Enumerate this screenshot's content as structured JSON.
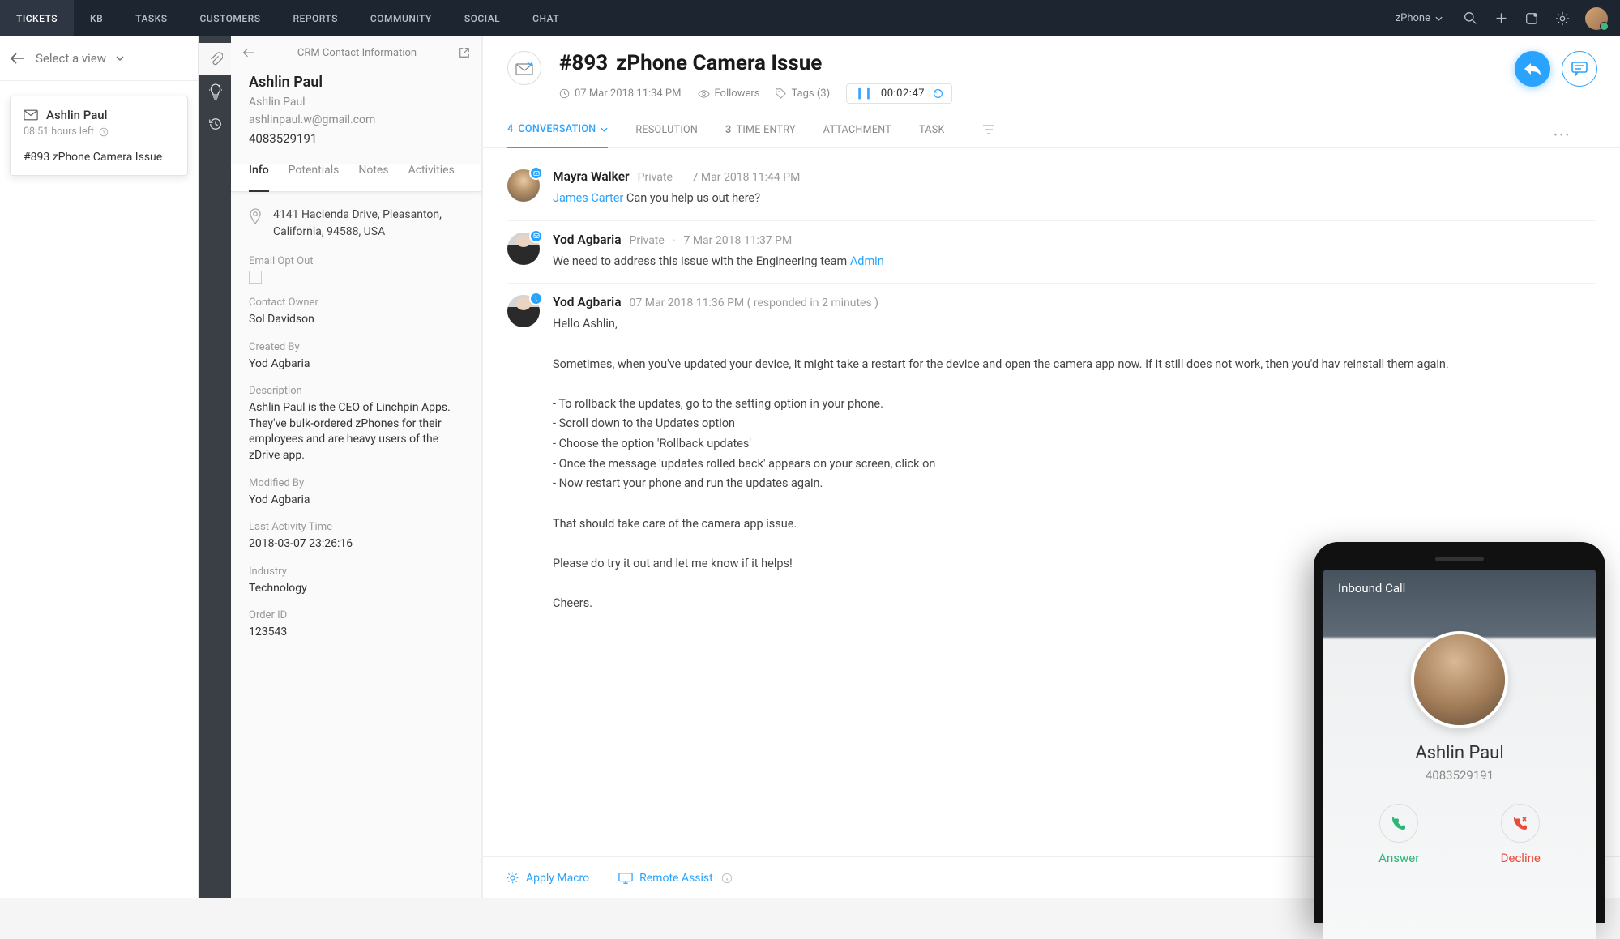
{
  "topnav": {
    "tabs": [
      "TICKETS",
      "KB",
      "TASKS",
      "CUSTOMERS",
      "REPORTS",
      "COMMUNITY",
      "SOCIAL",
      "CHAT"
    ],
    "active": 0,
    "department": "zPhone"
  },
  "view_selector": {
    "label": "Select a view"
  },
  "ticket_card": {
    "name": "Ashlin Paul",
    "timeleft": "08:51 hours left",
    "subject": "#893  zPhone Camera Issue"
  },
  "crm": {
    "header": "CRM Contact Information",
    "name": "Ashlin Paul",
    "sub": "Ashlin Paul",
    "email": "ashlinpaul.w@gmail.com",
    "phone": "4083529191",
    "tabs": [
      "Info",
      "Potentials",
      "Notes",
      "Activities"
    ],
    "address": "4141 Hacienda Drive, Pleasanton, California, 94588, USA",
    "fields": {
      "email_opt_out": {
        "label": "Email Opt Out"
      },
      "contact_owner": {
        "label": "Contact Owner",
        "value": "Sol Davidson"
      },
      "created_by": {
        "label": "Created By",
        "value": "Yod Agbaria"
      },
      "description": {
        "label": "Description",
        "value": "Ashlin Paul is the CEO of Linchpin Apps. They've bulk-ordered zPhones for their employees and are heavy users of the zDrive app."
      },
      "modified_by": {
        "label": "Modified By",
        "value": "Yod Agbaria"
      },
      "last_activity": {
        "label": "Last Activity Time",
        "value": "2018-03-07 23:26:16"
      },
      "industry": {
        "label": "Industry",
        "value": "Technology"
      },
      "order_id": {
        "label": "Order ID",
        "value": "123543"
      }
    }
  },
  "ticket": {
    "number": "#893",
    "title": "zPhone Camera Issue",
    "created": "07 Mar 2018 11:34 PM",
    "followers": "Followers",
    "tags": "Tags (3)",
    "timer": "00:02:47",
    "tabs": {
      "conversation": {
        "count": "4",
        "label": "CONVERSATION"
      },
      "resolution": "RESOLUTION",
      "time_entry": {
        "count": "3",
        "label": "TIME ENTRY"
      },
      "attachment": "ATTACHMENT",
      "task": "TASK"
    },
    "messages": [
      {
        "author": "Mayra Walker",
        "meta": "Private",
        "time": "7 Mar 2018 11:44 PM",
        "mention": "James Carter",
        "after_mention": " Can you help us out here?"
      },
      {
        "author": "Yod Agbaria",
        "meta": "Private",
        "time": "7 Mar 2018 11:37 PM",
        "text": "We need to address this issue with the Engineering team ",
        "mention": "Admin"
      },
      {
        "author": "Yod Agbaria",
        "meta": "07 Mar 2018 11:36 PM ( responded in 2 minutes )",
        "greeting": "Hello Ashlin,",
        "p1": "Sometimes, when you've updated your device, it might take a restart for the device and open the camera app now. If it still does not work, then you'd hav reinstall them again.",
        "l1": "- To rollback the updates, go to the setting option in your phone.",
        "l2": "- Scroll down to the Updates option",
        "l3": "- Choose the option 'Rollback updates'",
        "l4": "- Once the message 'updates rolled back' appears on your screen, click on",
        "l5": "- Now restart your phone and run the updates again.",
        "p2": "That should take care of the camera app issue.",
        "p3": "Please do try it out and let me know if it helps!",
        "p4": "Cheers."
      }
    ],
    "footer": {
      "apply_macro": "Apply Macro",
      "remote_assist": "Remote Assist"
    }
  },
  "phone": {
    "title": "Inbound Call",
    "name": "Ashlin Paul",
    "number": "4083529191",
    "answer": "Answer",
    "decline": "Decline"
  }
}
